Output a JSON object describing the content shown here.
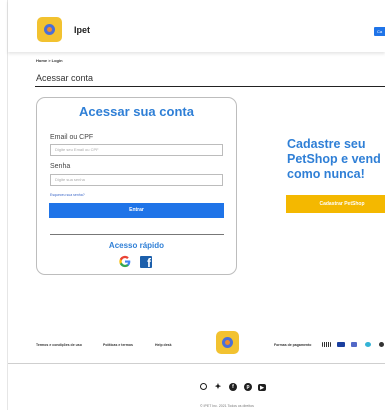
{
  "brand": {
    "name": "Ipet"
  },
  "header": {
    "button_label": "Ca"
  },
  "breadcrumb": "Home > Login",
  "page_title": "Acessar conta",
  "login_card": {
    "title": "Acessar sua conta",
    "email_label": "Email ou CPF",
    "email_placeholder": "Digite seu Email ou CPF",
    "password_label": "Senha",
    "password_placeholder": "Digite sua senha",
    "forgot_password": "Esqueceu sua senha?",
    "submit_label": "Entrar",
    "quick_access_title": "Acesso rápido"
  },
  "promo": {
    "title_lines": [
      "Cadastre seu",
      "PetShop e vend",
      "como nunca!"
    ],
    "button_label": "Cadastrar PetShop"
  },
  "footer": {
    "links": [
      "Termos e condições de uso",
      "Políticas e termos",
      "Help desk"
    ],
    "payment_label": "Formas de pagamento",
    "copyright": "© IPET Inc. 2021 Todos os direitos"
  },
  "colors": {
    "primary_blue": "#1f74e8",
    "heading_blue": "#2f7fd6",
    "accent_yellow": "#f4b800",
    "logo_yellow": "#f2c230"
  },
  "icons": {
    "social": [
      "instagram-icon",
      "twitter-icon",
      "facebook-icon",
      "pinterest-icon",
      "youtube-icon"
    ],
    "payment": [
      "boleto-icon",
      "visa-icon",
      "mastercard-icon",
      "elo-icon",
      "pix-icon"
    ],
    "quick_access": [
      "google-icon",
      "facebook-icon"
    ]
  }
}
